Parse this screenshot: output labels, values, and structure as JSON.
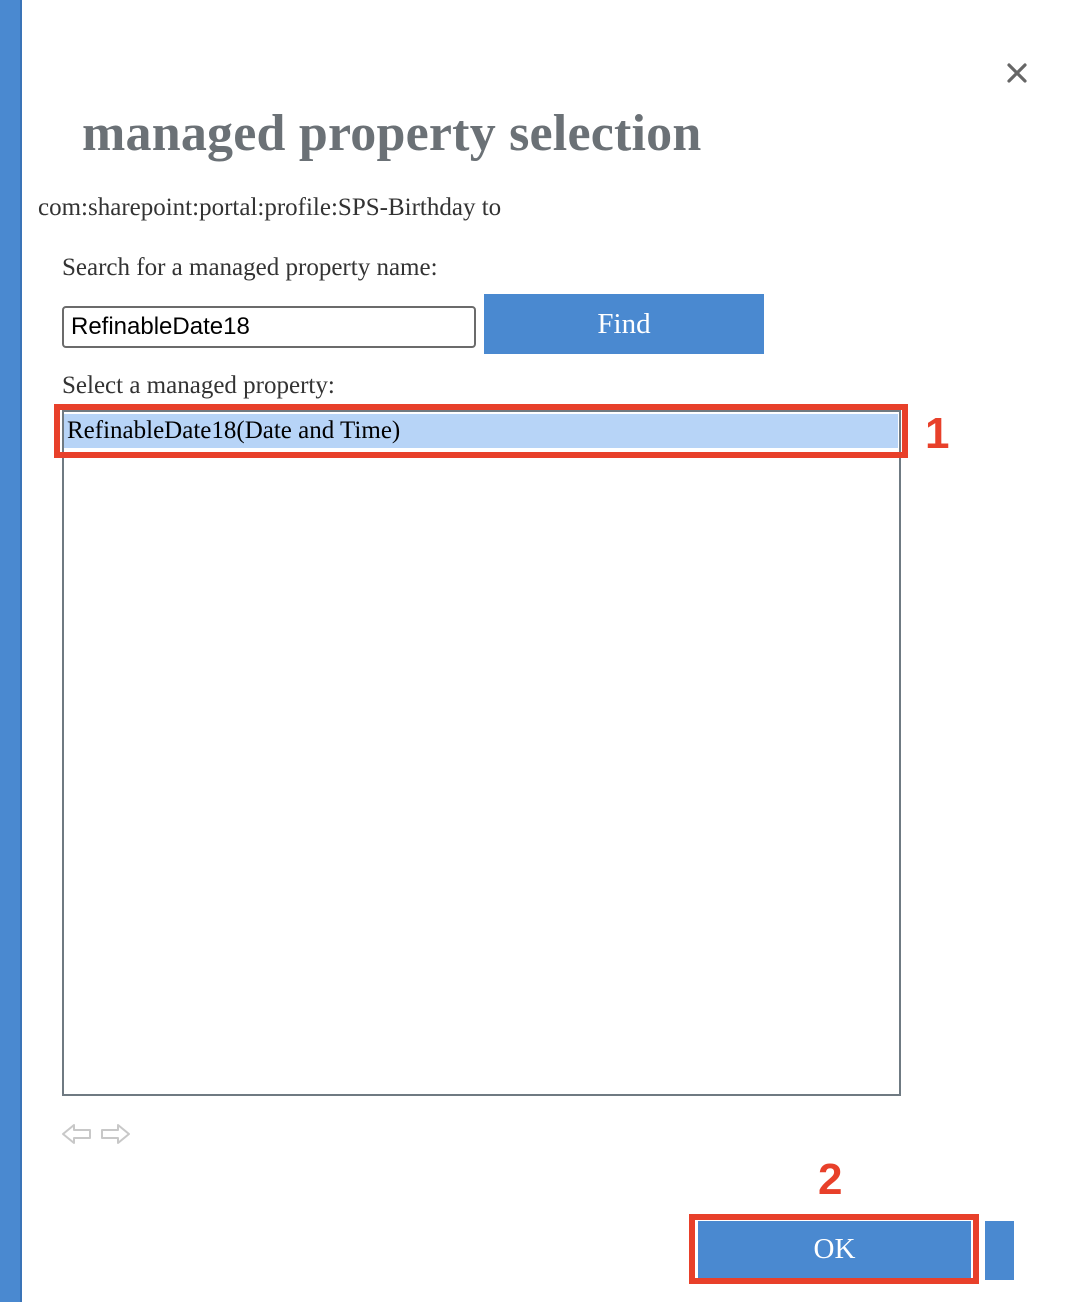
{
  "dialog": {
    "title": "managed property selection",
    "subtitle": "com:sharepoint:portal:profile:SPS-Birthday to",
    "close_icon": "close-icon"
  },
  "search": {
    "label": "Search for a managed property name:",
    "value": "RefinableDate18",
    "find_label": "Find"
  },
  "list": {
    "label": "Select a managed property:",
    "items": [
      {
        "label": "RefinableDate18(Date and Time)",
        "selected": true
      }
    ]
  },
  "pager": {
    "prev_icon": "arrow-left-icon",
    "next_icon": "arrow-right-icon"
  },
  "footer": {
    "ok_label": "OK"
  },
  "annotations": {
    "step1": "1",
    "step2": "2"
  },
  "colors": {
    "accent": "#4a89d0",
    "selection": "#b7d4f7",
    "highlight": "#e8402a",
    "title_gray": "#6b7176"
  }
}
